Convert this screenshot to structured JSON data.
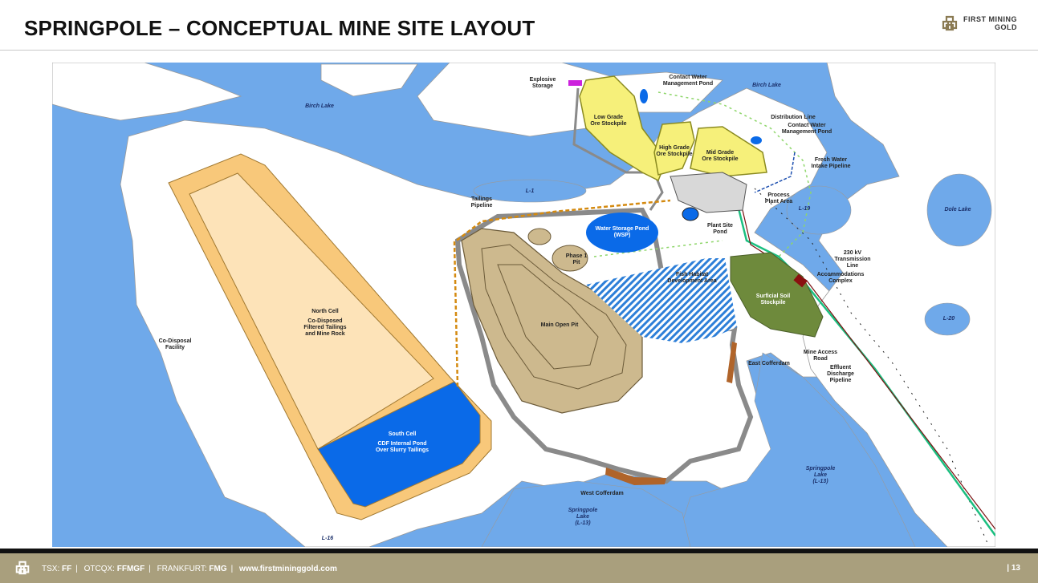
{
  "header": {
    "title": "SPRINGPOLE – CONCEPTUAL MINE SITE LAYOUT",
    "logo_line1": "FIRST MINING",
    "logo_line2": "GOLD"
  },
  "map": {
    "colors": {
      "water": "#6fa9ea",
      "land": "#ffffff",
      "tailings_dam": "#f8c87a",
      "north_cell": "#fde3b8",
      "south_cell": "#0a6ae8",
      "stockpile": "#f6f07a",
      "pit": "#cdb98e",
      "soil": "#6e8a3c",
      "road": "#8a8a8a",
      "cofferdam": "#b0642a"
    },
    "labels": {
      "explosive_storage": [
        "Explosive",
        "Storage"
      ],
      "contact_water_pond_1": [
        "Contact Water",
        "Management Pond"
      ],
      "birch_lake_1": "Birch Lake",
      "birch_lake_2": "Birch Lake",
      "low_grade": [
        "Low Grade",
        "Ore Stockpile"
      ],
      "high_grade": [
        "High Grade",
        "Ore Stockpile"
      ],
      "mid_grade": [
        "Mid Grade",
        "Ore Stockpile"
      ],
      "distribution_line": "Distribution Line",
      "contact_water_pond_2": [
        "Contact Water",
        "Management Pond"
      ],
      "fresh_water": [
        "Fresh Water",
        "Intake Pipeline"
      ],
      "process_plant": [
        "Process",
        "Plant Area"
      ],
      "l1": "L-1",
      "l19": "L-19",
      "dole_lake": "Dole Lake",
      "tailings_pipeline": [
        "Tailings",
        "Pipeline"
      ],
      "wsp": [
        "Water Storage Pond",
        "(WSP)"
      ],
      "plant_site_pond": [
        "Plant Site",
        "Pond"
      ],
      "phase1": [
        "Phase 1",
        "Pit"
      ],
      "fish_habitat": [
        "Fish Habitat",
        "Development Area"
      ],
      "transmission": [
        "230 kV",
        "Transmission",
        "Line"
      ],
      "accommodations": [
        "Accommodations",
        "Complex"
      ],
      "soil": [
        "Surficial Soil",
        "Stockpile"
      ],
      "l20": "L-20",
      "north_cell": [
        "North Cell",
        "Co-Disposed",
        "Filtered Tailings",
        "and Mine Rock"
      ],
      "co_disposal": [
        "Co-Disposal",
        "Facility"
      ],
      "main_pit": "Main Open Pit",
      "east_cofferdam": "East Cofferdam",
      "mine_access": [
        "Mine Access",
        "Road"
      ],
      "effluent": [
        "Effluent",
        "Discharge",
        "Pipeline"
      ],
      "south_cell": [
        "South Cell",
        "CDF Internal Pond",
        "Over Slurry Tailings"
      ],
      "springpole_east": [
        "Springpole",
        "Lake",
        "(L-13)"
      ],
      "west_cofferdam": "West Cofferdam",
      "springpole_south": [
        "Springpole",
        "Lake",
        "(L-13)"
      ],
      "l16": "L-16"
    }
  },
  "footer": {
    "tsx_label": "TSX:",
    "tsx": "FF",
    "otcqx_label": "OTCQX:",
    "otcqx": "FFMGF",
    "frankfurt_label": "FRANKFURT:",
    "frankfurt": "FMG",
    "website": "www.firstmininggold.com",
    "page": "| 13"
  }
}
